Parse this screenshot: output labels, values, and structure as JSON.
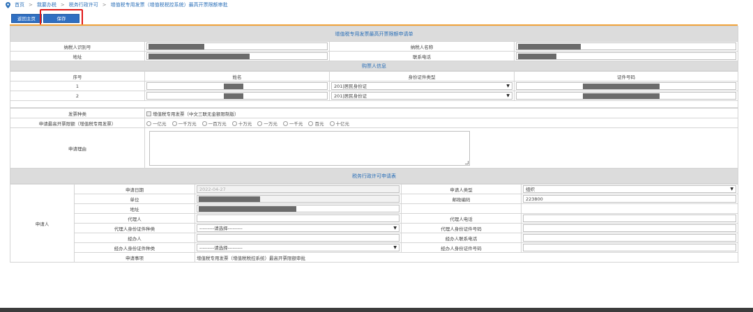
{
  "breadcrumb": [
    "首页",
    "我要办税",
    "税务行政许可",
    "增值税专用发票（增值税税控系统）最高开票限额审批"
  ],
  "toolbar": {
    "back_label": "返回主页",
    "save_label": "保存"
  },
  "form": {
    "title": "增值税专用发票最高开票限额申请单",
    "taxpayer_id_label": "纳税人识别号",
    "taxpayer_name_label": "纳税人名称",
    "address_label": "地址",
    "phone_label": "联系电话",
    "buyer_section": "购票人信息",
    "buyer_headers": [
      "序号",
      "姓名",
      "身份证件类型",
      "证件号码"
    ],
    "buyers": [
      {
        "no": "1",
        "id_type": "201|居民身份证"
      },
      {
        "no": "2",
        "id_type": "201|居民身份证"
      }
    ],
    "invoice_type_label": "发票种类",
    "invoice_type_option": "增值税专用发票（中文三联无金额限制版）",
    "limit_label": "申请最高开票限额（增值税专用发票）",
    "limit_options": [
      "一亿元",
      "一千万元",
      "一百万元",
      "十万元",
      "一万元",
      "一千元",
      "百元",
      "十亿元"
    ],
    "reason_label": "申请理由"
  },
  "permit": {
    "title": "税务行政许可申请表",
    "applicant_label": "申请人",
    "apply_date_label": "申请日期",
    "apply_date_value": "2022-04-27",
    "applicant_type_label": "申请人类型",
    "applicant_type_value": "组织",
    "unit_label": "单位",
    "postcode_label": "邮政编码",
    "postcode_value": "223800",
    "address_label": "地址",
    "agent_label": "代理人",
    "agent_phone_label": "代理人电话",
    "agent_id_type_label": "代理人身份证件种类",
    "agent_id_no_label": "代理人身份证件号码",
    "handler_label": "经办人",
    "handler_phone_label": "经办人联系电话",
    "handler_id_type_label": "经办人身份证件种类",
    "handler_id_no_label": "经办人身份证件号码",
    "select_placeholder": "---------请选择---------",
    "matter_label": "申请事项",
    "matter_value": "增值税专用发票（增值税税控系统）最高开票限额审批"
  }
}
